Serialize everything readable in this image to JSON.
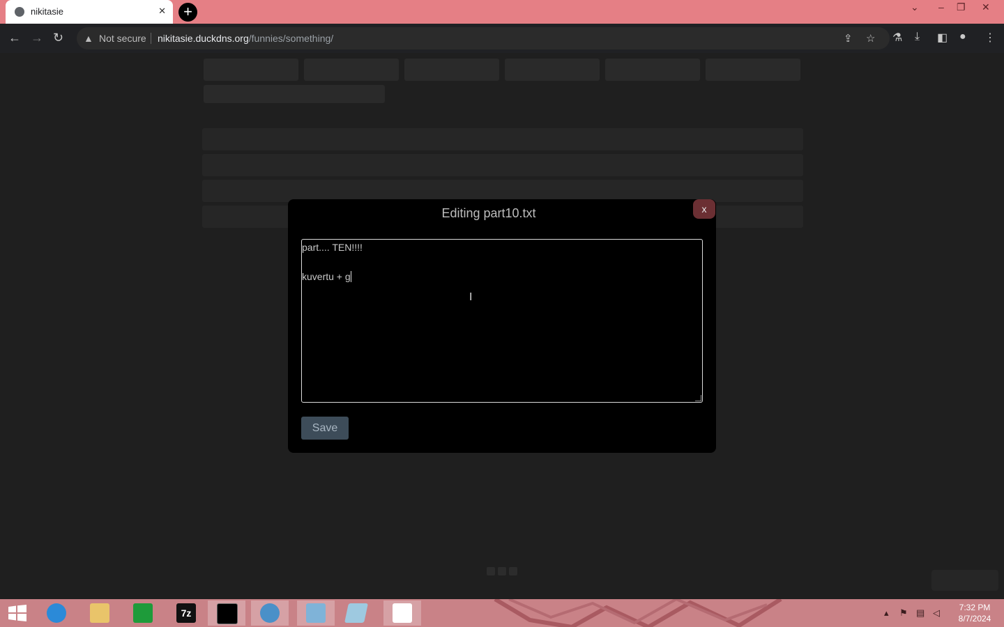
{
  "browser": {
    "tab_title": "nikitasie",
    "tab_close": "✕",
    "new_tab": "+",
    "security_label": "Not secure",
    "url_host": "nikitasie.duckdns.org",
    "url_path": "/funnies/something/"
  },
  "modal": {
    "title": "Editing part10.txt",
    "close_label": "x",
    "content_line1": "part.... TEN!!!!",
    "content_line2": "kuvertu + g",
    "save_label": "Save"
  },
  "taskbar": {
    "time": "7:32 PM",
    "date": "8/7/2024",
    "apps": [
      "internet-explorer-icon",
      "file-explorer-icon",
      "store-icon",
      "7zip-icon",
      "cmd-icon",
      "app-globe-icon",
      "photos-icon",
      "notepad-icon",
      "windows-tiles-icon"
    ]
  },
  "colors": {
    "tabbar": "#e57f85",
    "taskbar": "#c98287",
    "save_button": "#3d4c59",
    "modal_close": "#6b2f33"
  }
}
